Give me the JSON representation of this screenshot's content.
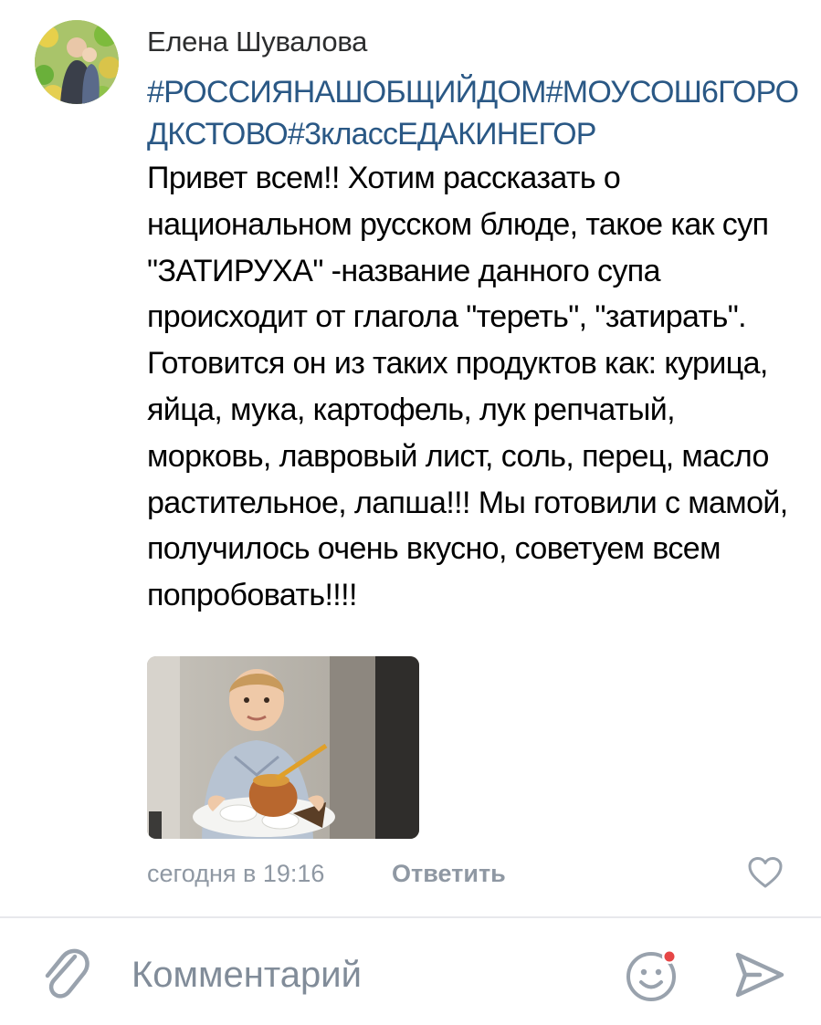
{
  "comment": {
    "author": "Елена Шувалова",
    "hashtags": "#РОССИЯНАШОБЩИЙДОМ#МОУСОШ6ГОРОДКСТОВО#3классЕДАКИНЕГОР",
    "text": "Привет всем!! Хотим рассказать о национальном русском блюде, такое как суп \"ЗАТИРУХА\" -название данного супа происходит от глагола \"тереть\", \"затирать\". Готовится он из таких продуктов как: курица, яйца, мука, картофель, лук репчатый, морковь, лавровый лист, соль, перец, масло растительное, лапша!!! Мы готовили с мамой, получилось очень вкусно, советуем всем попробовать!!!!",
    "timestamp": "сегодня в 19:16",
    "reply_label": "Ответить"
  },
  "composer": {
    "placeholder": "Комментарий"
  },
  "icons": {
    "attach": "paperclip-icon",
    "emoji": "smiley-icon",
    "send": "send-arrow-icon",
    "like": "heart-icon"
  },
  "colors": {
    "hashtag": "#2a5885",
    "meta_text": "#8f98a3",
    "icon_gray": "#99a2ad",
    "notification_dot": "#e64646"
  }
}
